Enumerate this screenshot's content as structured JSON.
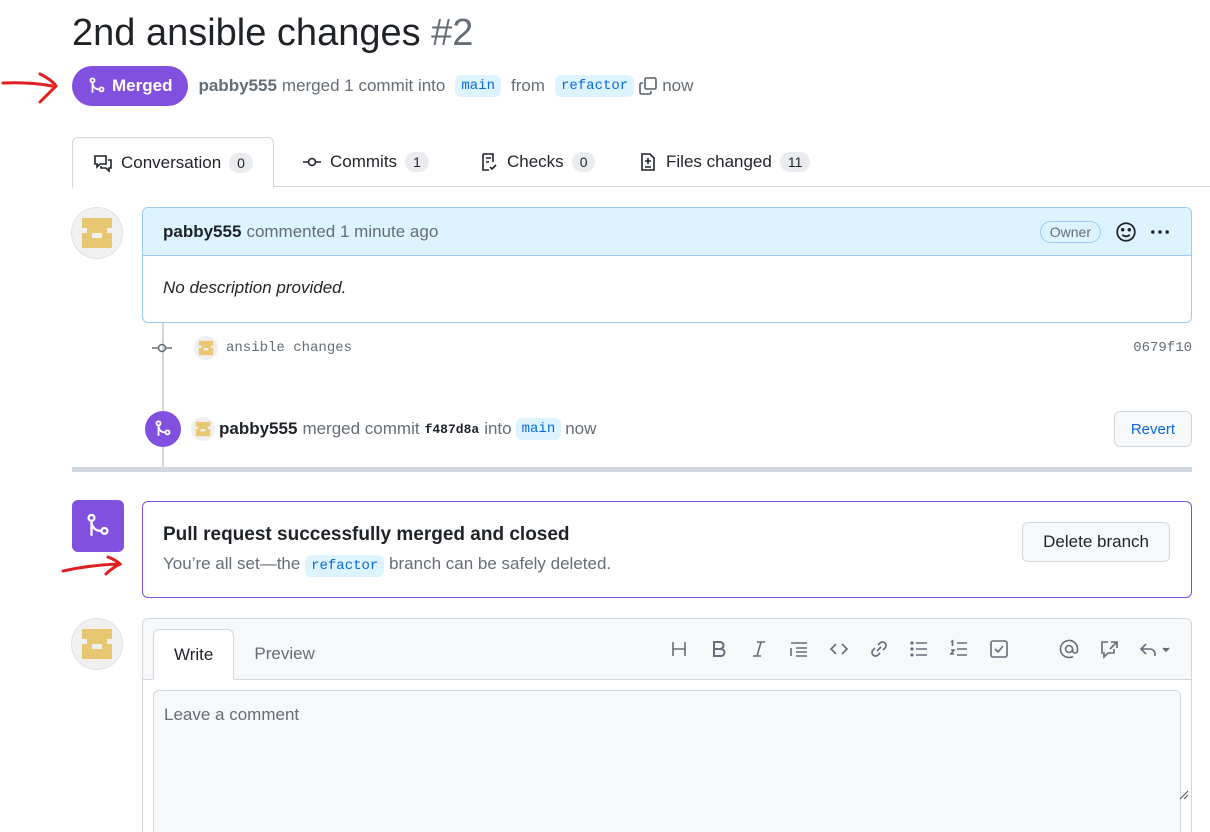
{
  "pr": {
    "title": "2nd ansible changes",
    "number": "#2",
    "state_label": "Merged",
    "author": "pabby555",
    "summary_merged": "merged 1 commit into",
    "base_branch": "main",
    "from_word": "from",
    "head_branch": "refactor",
    "time": "now"
  },
  "tabs": [
    {
      "label": "Conversation",
      "count": "0",
      "icon": "comment-discussion-icon"
    },
    {
      "label": "Commits",
      "count": "1",
      "icon": "git-commit-icon"
    },
    {
      "label": "Checks",
      "count": "0",
      "icon": "checklist-icon"
    },
    {
      "label": "Files changed",
      "count": "11",
      "icon": "file-diff-icon"
    }
  ],
  "comment": {
    "author": "pabby555",
    "action": "commented 1 minute ago",
    "badge": "Owner",
    "body": "No description provided."
  },
  "commit": {
    "message": "ansible changes",
    "sha": "0679f10"
  },
  "merge_event": {
    "author": "pabby555",
    "text": "merged commit",
    "sha": "f487d8a",
    "into": "into",
    "branch": "main",
    "time": "now",
    "revert_label": "Revert"
  },
  "merged_box": {
    "heading": "Pull request successfully merged and closed",
    "sub_before": "You’re all set—the",
    "branch": "refactor",
    "sub_after": "branch can be safely deleted.",
    "delete_label": "Delete branch"
  },
  "editor": {
    "write_tab": "Write",
    "preview_tab": "Preview",
    "placeholder": "Leave a comment",
    "toolbar_icons": [
      "heading-icon",
      "bold-icon",
      "italic-icon",
      "quote-icon",
      "code-icon",
      "link-icon",
      "unordered-list-icon",
      "ordered-list-icon",
      "task-list-icon",
      "mention-icon",
      "cross-reference-icon",
      "saved-reply-icon"
    ]
  },
  "colors": {
    "merged_purple": "#8250df",
    "link_blue": "#0969da",
    "annotation_red": "#e02020",
    "header_blue": "#ddf4ff"
  }
}
